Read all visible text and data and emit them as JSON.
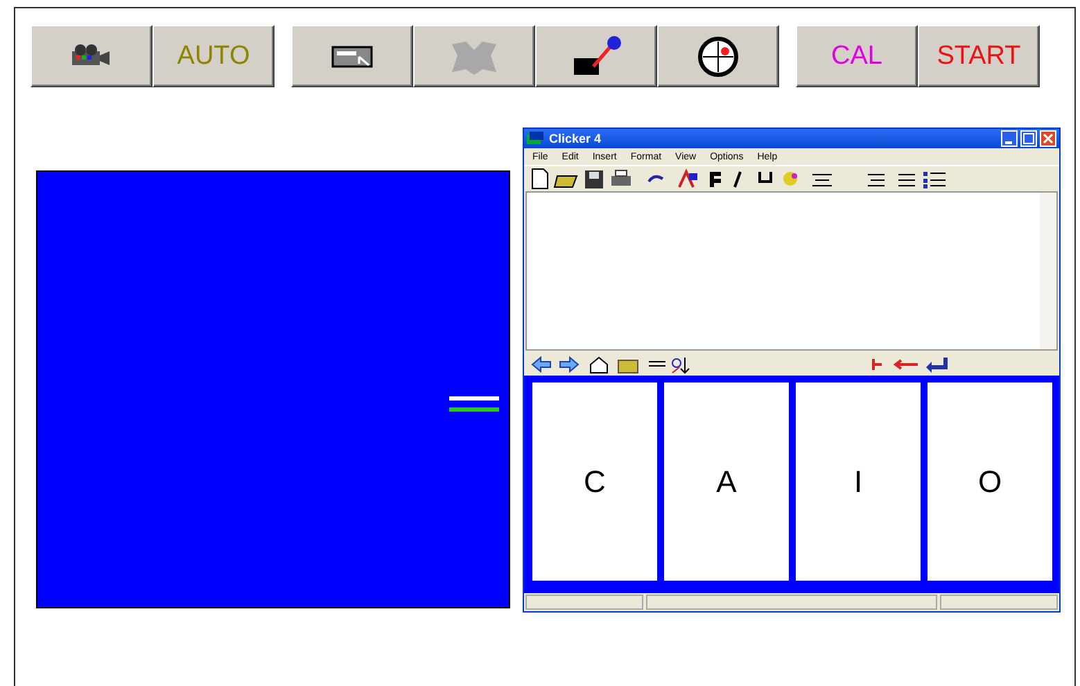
{
  "toolbar_groups": [
    {
      "buttons": [
        {
          "kind": "icon"
        },
        {
          "kind": "text",
          "label": "AUTO",
          "color": "#8c8500"
        }
      ]
    },
    {
      "buttons": [
        {
          "kind": "icon"
        },
        {
          "kind": "icon",
          "disabled": true
        },
        {
          "kind": "icon"
        },
        {
          "kind": "icon"
        }
      ]
    },
    {
      "buttons": [
        {
          "kind": "text",
          "label": "CAL",
          "color": "#e000e0"
        },
        {
          "kind": "text",
          "label": "START",
          "color": "#ee1111"
        }
      ]
    }
  ],
  "clicker_window": {
    "title": "Clicker 4",
    "menu": [
      "File",
      "Edit",
      "Insert",
      "Format",
      "View",
      "Options",
      "Help"
    ],
    "grid_cells": [
      {
        "label": "C"
      },
      {
        "label": "A"
      },
      {
        "label": "I"
      },
      {
        "label": "O"
      }
    ]
  }
}
